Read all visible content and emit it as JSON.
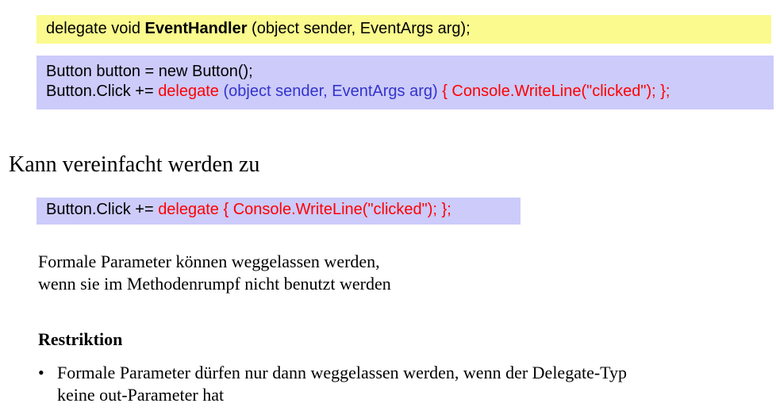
{
  "colors": {
    "yellow_box": "#fafa8e",
    "lavender_box": "#cccbfa",
    "keyword_red": "#ff0000",
    "params_blue": "#3333cc",
    "text": "#000000"
  },
  "code_box_1": {
    "prefix": "delegate void ",
    "name": "EventHandler",
    "suffix": " (object sender, EventArgs arg);"
  },
  "code_box_2": {
    "line1": "Button button = new Button();",
    "line2_prefix": "Button.Click += ",
    "line2_keyword": "delegate",
    "line2_params": " (object sender, EventArgs arg)",
    "line2_body": " { Console.WriteLine(\"clicked\"); };"
  },
  "heading": "Kann vereinfacht werden zu",
  "code_box_3": {
    "prefix": "Button.Click += ",
    "keyword": "delegate",
    "body": " { Console.WriteLine(\"clicked\"); };"
  },
  "paragraph": {
    "line1": "Formale Parameter können weggelassen werden,",
    "line2": "wenn sie im Methodenrumpf nicht benutzt werden"
  },
  "restriction": {
    "title": "Restriktion",
    "bullet_symbol": "•",
    "items": [
      {
        "line1": "Formale Parameter dürfen nur dann weggelassen werden, wenn der Delegate-Typ",
        "line2": "keine out-Parameter hat"
      }
    ]
  }
}
